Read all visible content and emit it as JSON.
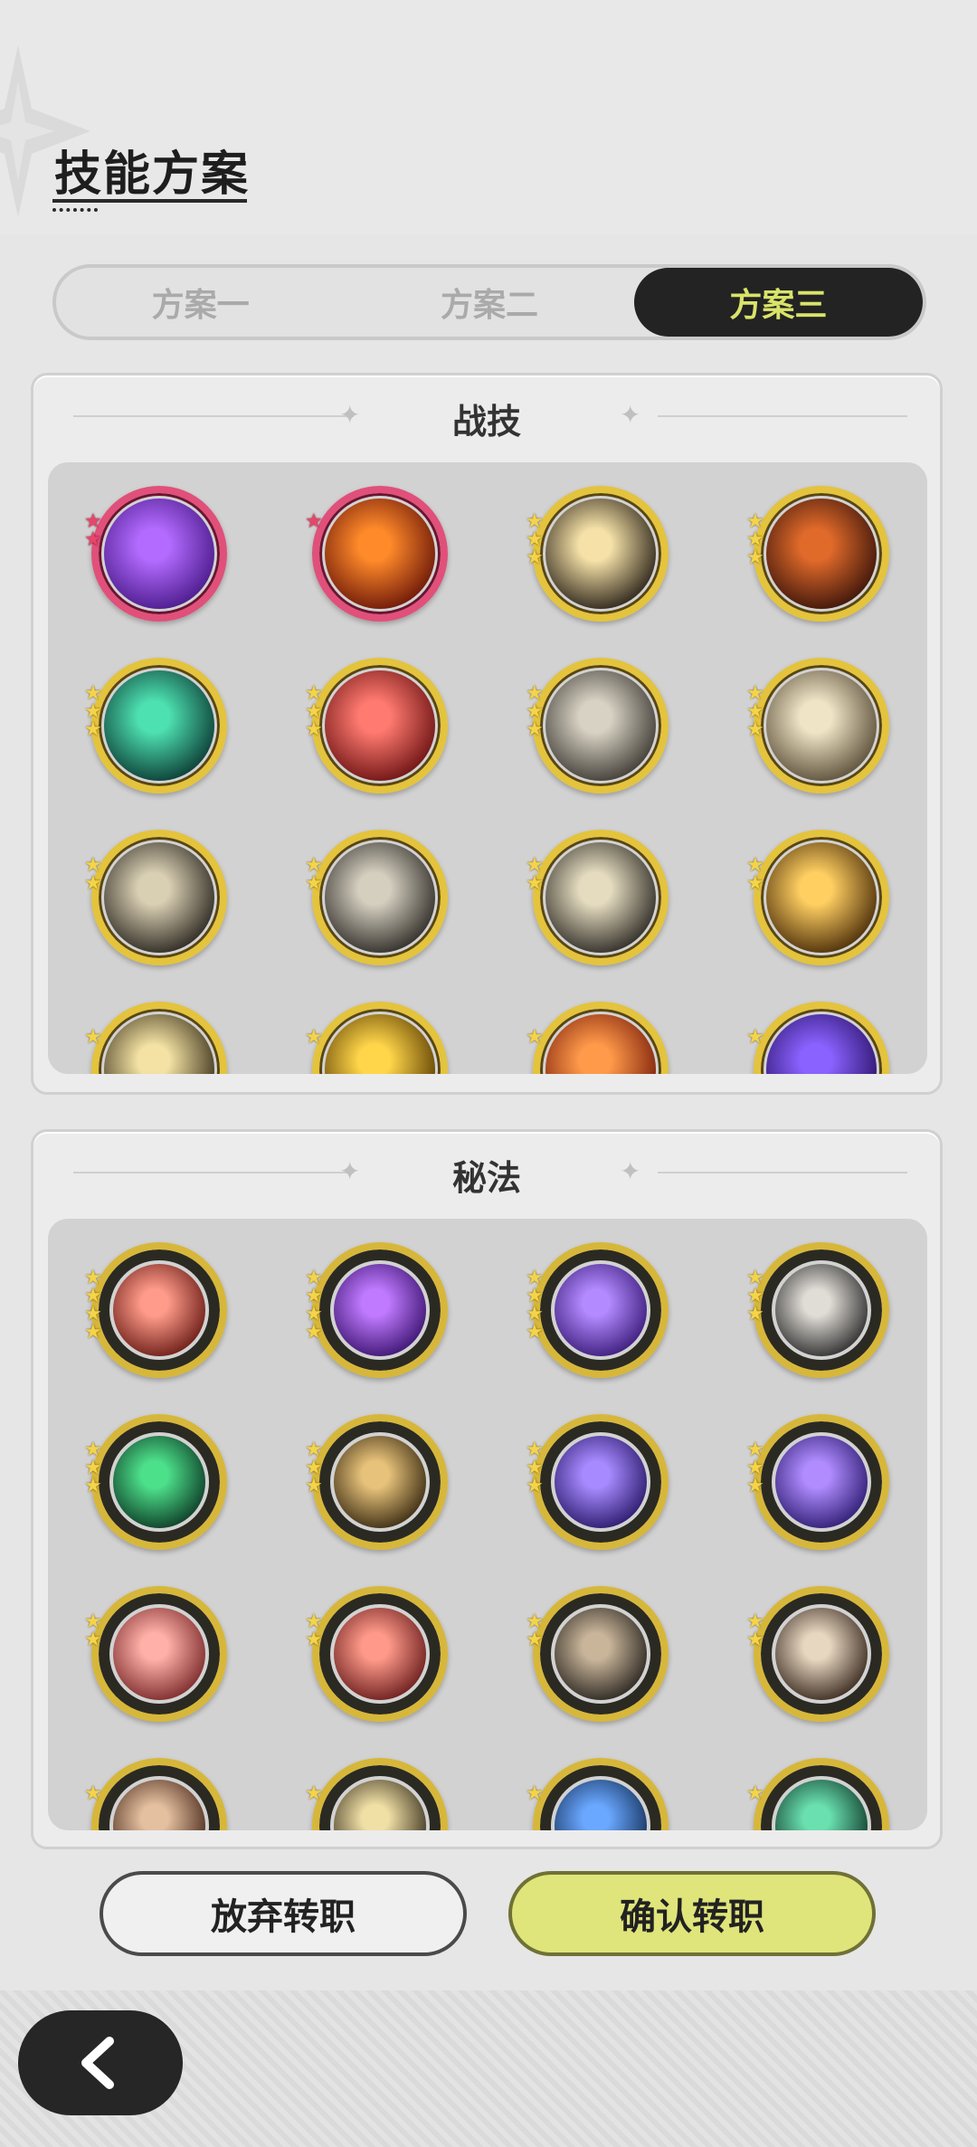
{
  "header": {
    "title": "技能方案"
  },
  "tabs": [
    {
      "label": "方案一",
      "active": false
    },
    {
      "label": "方案二",
      "active": false
    },
    {
      "label": "方案三",
      "active": true
    }
  ],
  "sections": [
    {
      "title": "战技",
      "skills": [
        {
          "icon": "purple-heart-burst-icon",
          "stars": 2,
          "star_color": "pink"
        },
        {
          "icon": "fire-swirl-icon",
          "stars": 1,
          "star_color": "pink"
        },
        {
          "icon": "explosion-burst-icon",
          "stars": 3,
          "star_color": "gold"
        },
        {
          "icon": "flame-orb-icon",
          "stars": 3,
          "star_color": "gold"
        },
        {
          "icon": "green-slash-icon",
          "stars": 3,
          "star_color": "gold"
        },
        {
          "icon": "raised-sword-figure-icon",
          "stars": 3,
          "star_color": "gold"
        },
        {
          "icon": "charging-beasts-icon",
          "stars": 3,
          "star_color": "gold"
        },
        {
          "icon": "sparkling-shield-icon",
          "stars": 3,
          "star_color": "gold"
        },
        {
          "icon": "wind-slash-icon",
          "stars": 2,
          "star_color": "gold"
        },
        {
          "icon": "spin-slash-icon",
          "stars": 2,
          "star_color": "gold"
        },
        {
          "icon": "tornado-icon",
          "stars": 2,
          "star_color": "gold"
        },
        {
          "icon": "golden-swirl-icon",
          "stars": 2,
          "star_color": "gold"
        },
        {
          "icon": "skill-icon",
          "stars": 1,
          "star_color": "gold"
        },
        {
          "icon": "skill-icon",
          "stars": 1,
          "star_color": "gold"
        },
        {
          "icon": "skill-icon",
          "stars": 1,
          "star_color": "gold"
        },
        {
          "icon": "skill-icon",
          "stars": 1,
          "star_color": "gold"
        }
      ]
    },
    {
      "title": "秘法",
      "skills": [
        {
          "icon": "red-rune-orb-icon",
          "stars": 4,
          "star_color": "gold"
        },
        {
          "icon": "purple-flame-icon",
          "stars": 4,
          "star_color": "gold"
        },
        {
          "icon": "purple-seal-icon",
          "stars": 4,
          "star_color": "gold"
        },
        {
          "icon": "shield-figure-icon",
          "stars": 3,
          "star_color": "gold"
        },
        {
          "icon": "green-crystal-icon",
          "stars": 3,
          "star_color": "gold"
        },
        {
          "icon": "armor-icon",
          "stars": 3,
          "star_color": "gold"
        },
        {
          "icon": "purple-beast-icon",
          "stars": 3,
          "star_color": "gold"
        },
        {
          "icon": "purple-aura-figure-icon",
          "stars": 3,
          "star_color": "gold"
        },
        {
          "icon": "pink-sword-icon",
          "stars": 2,
          "star_color": "gold"
        },
        {
          "icon": "red-armor-icon",
          "stars": 2,
          "star_color": "gold"
        },
        {
          "icon": "claw-icon",
          "stars": 2,
          "star_color": "gold"
        },
        {
          "icon": "heart-shield-icon",
          "stars": 2,
          "star_color": "gold"
        },
        {
          "icon": "skill-icon",
          "stars": 1,
          "star_color": "gold"
        },
        {
          "icon": "skill-icon",
          "stars": 1,
          "star_color": "gold"
        },
        {
          "icon": "skill-icon",
          "stars": 1,
          "star_color": "gold"
        },
        {
          "icon": "skill-icon",
          "stars": 1,
          "star_color": "gold"
        }
      ]
    }
  ],
  "buttons": {
    "cancel": "放弃转职",
    "confirm": "确认转职"
  },
  "colors": {
    "accent": "#d9e36a",
    "dark": "#232323",
    "gold": "#e4c33d",
    "pink": "#e0507a"
  }
}
